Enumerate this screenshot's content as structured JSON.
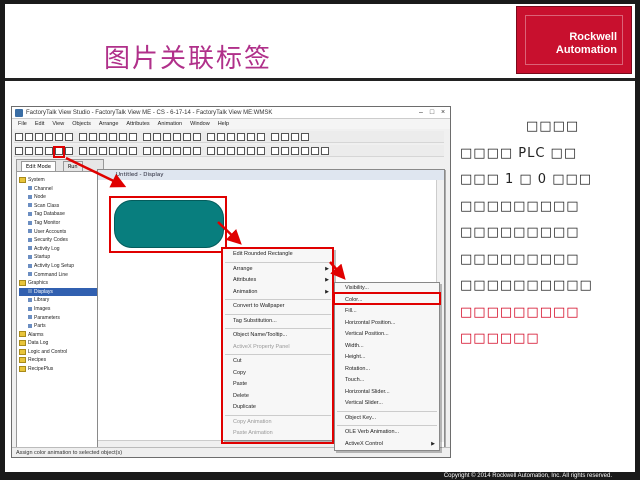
{
  "slide": {
    "title": "图片关联标签",
    "logo": {
      "line1": "Rockwell",
      "line2": "Automation"
    },
    "footer": "Copyright © 2014 Rockwell Automation, Inc. All rights reserved.",
    "description": {
      "line1": "□□□□",
      "line2": "□□□□ PLC □□",
      "line3": "□□□ 1 □ 0 □□□",
      "line4": "□□□□□□□□□",
      "line5": "□□□□□□□□□",
      "line6": "□□□□□□□□□",
      "line7": "□□□□□□□□□□",
      "red_line1": "□□□□□□□□□",
      "red_line2": "□□□□□□"
    }
  },
  "app": {
    "window_title": "FactoryTalk View Studio - FactoryTalk View ME - CS - 6-17-14 - FactoryTalk View ME:WMSK",
    "menus": [
      "File",
      "Edit",
      "View",
      "Objects",
      "Arrange",
      "Attributes",
      "Animation",
      "Window",
      "Help"
    ],
    "display_title": "Untitled - Display",
    "explorer_tabs": [
      "Edit Mode",
      "Run"
    ],
    "tree": [
      {
        "label": "System",
        "type": "folder"
      },
      {
        "label": "Channel",
        "type": "item"
      },
      {
        "label": "Node",
        "type": "item"
      },
      {
        "label": "Scan Class",
        "type": "item"
      },
      {
        "label": "Tag Database",
        "type": "item"
      },
      {
        "label": "Tag Monitor",
        "type": "item"
      },
      {
        "label": "User Accounts",
        "type": "item"
      },
      {
        "label": "Security Codes",
        "type": "item"
      },
      {
        "label": "Activity Log",
        "type": "item"
      },
      {
        "label": "Startup",
        "type": "item"
      },
      {
        "label": "Activity Log Setup",
        "type": "item"
      },
      {
        "label": "Command Line",
        "type": "item"
      },
      {
        "label": "Graphics",
        "type": "folder"
      },
      {
        "label": "Displays",
        "type": "item",
        "selected": true
      },
      {
        "label": "Library",
        "type": "item"
      },
      {
        "label": "Images",
        "type": "item"
      },
      {
        "label": "Parameters",
        "type": "item"
      },
      {
        "label": "Parts",
        "type": "item"
      },
      {
        "label": "Alarms",
        "type": "folder"
      },
      {
        "label": "Data Log",
        "type": "folder"
      },
      {
        "label": "Logic and Control",
        "type": "folder"
      },
      {
        "label": "Recipes",
        "type": "folder"
      },
      {
        "label": "RecipePlus",
        "type": "folder"
      }
    ],
    "context_menu_1": [
      {
        "label": "Edit Rounded Rectangle"
      },
      {
        "sep": true
      },
      {
        "label": "Arrange",
        "submenu": true
      },
      {
        "label": "Attributes",
        "submenu": true
      },
      {
        "label": "Animation",
        "submenu": true
      },
      {
        "sep": true
      },
      {
        "label": "Convert to Wallpaper"
      },
      {
        "sep": true
      },
      {
        "label": "Tag Substitution..."
      },
      {
        "sep": true
      },
      {
        "label": "Object Name/Tooltip..."
      },
      {
        "label": "ActiveX Property Panel",
        "disabled": true
      },
      {
        "sep": true
      },
      {
        "label": "Cut"
      },
      {
        "label": "Copy"
      },
      {
        "label": "Paste"
      },
      {
        "label": "Delete"
      },
      {
        "label": "Duplicate"
      },
      {
        "sep": true
      },
      {
        "label": "Copy Animation",
        "disabled": true
      },
      {
        "label": "Paste Animation",
        "disabled": true
      }
    ],
    "context_menu_2": [
      {
        "label": "Visibility..."
      },
      {
        "label": "Color...",
        "highlight": true
      },
      {
        "label": "Fill..."
      },
      {
        "label": "Horizontal Position..."
      },
      {
        "label": "Vertical Position..."
      },
      {
        "label": "Width..."
      },
      {
        "label": "Height..."
      },
      {
        "label": "Rotation..."
      },
      {
        "label": "Touch..."
      },
      {
        "label": "Horizontal Slider..."
      },
      {
        "label": "Vertical Slider..."
      },
      {
        "sep": true
      },
      {
        "label": "Object Key..."
      },
      {
        "sep": true
      },
      {
        "label": "OLE Verb Animation..."
      },
      {
        "label": "ActiveX Control",
        "submenu": true
      }
    ],
    "status_text": "Assign color animation to selected object(s)"
  },
  "colors": {
    "title": "#b0308a",
    "logo_bg": "#c8102e",
    "accent_red": "#d2001e",
    "shape_fill": "#087e7e"
  }
}
